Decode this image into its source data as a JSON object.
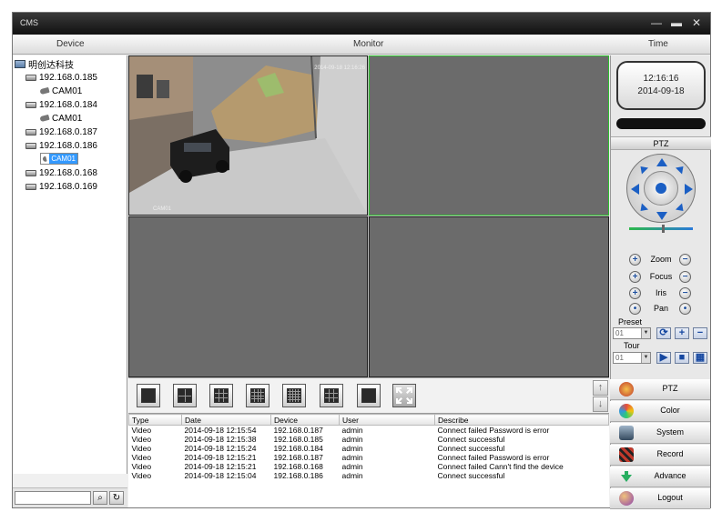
{
  "window": {
    "title": "CMS",
    "minimize_glyph": "—",
    "maximize_glyph": "▬",
    "close_glyph": "✕"
  },
  "columns": {
    "device": "Device",
    "monitor": "Monitor",
    "time": "Time"
  },
  "tree": {
    "root": "明创达科技",
    "nodes": [
      {
        "label": "192.168.0.185",
        "kind": "dvr"
      },
      {
        "label": "CAM01",
        "kind": "cam"
      },
      {
        "label": "192.168.0.184",
        "kind": "dvr"
      },
      {
        "label": "CAM01",
        "kind": "cam"
      },
      {
        "label": "192.168.0.187",
        "kind": "dvr"
      },
      {
        "label": "192.168.0.186",
        "kind": "dvr"
      },
      {
        "label": "CAM01",
        "kind": "cam",
        "selected": true
      },
      {
        "label": "192.168.0.168",
        "kind": "dvr"
      },
      {
        "label": "192.168.0.169",
        "kind": "dvr"
      }
    ]
  },
  "search": {
    "placeholder": "",
    "search_icon": "magnifier-icon",
    "refresh_icon": "refresh-icon"
  },
  "video": {
    "osd_time": "2014-09-18 12:16:26",
    "osd_name": "CAM01"
  },
  "layout_buttons": [
    "1x1",
    "2x2",
    "3x3",
    "4x4",
    "5x5",
    "6x6",
    "7x7",
    "fullscreen"
  ],
  "log": {
    "headers": [
      "Type",
      "Date",
      "Device",
      "User",
      "Describe"
    ],
    "rows": [
      [
        "Video",
        "2014-09-18 12:15:54",
        "192.168.0.187",
        "admin",
        "Connect failed Password is error"
      ],
      [
        "Video",
        "2014-09-18 12:15:38",
        "192.168.0.185",
        "admin",
        "Connect successful"
      ],
      [
        "Video",
        "2014-09-18 12:15:24",
        "192.168.0.184",
        "admin",
        "Connect successful"
      ],
      [
        "Video",
        "2014-09-18 12:15:21",
        "192.168.0.187",
        "admin",
        "Connect failed Password is error"
      ],
      [
        "Video",
        "2014-09-18 12:15:21",
        "192.168.0.168",
        "admin",
        "Connect failed Cann't find the device"
      ],
      [
        "Video",
        "2014-09-18 12:15:04",
        "192.168.0.186",
        "admin",
        "Connect successful"
      ]
    ]
  },
  "clock": {
    "time": "12:16:16",
    "date": "2014-09-18"
  },
  "ptz": {
    "title": "PTZ",
    "zoom": "Zoom",
    "focus": "Focus",
    "iris": "Iris",
    "pan": "Pan",
    "preset_label": "Preset",
    "preset_value": "01",
    "tour_label": "Tour",
    "tour_value": "01",
    "plus_glyph": "+",
    "minus_glyph": "−",
    "dot_glyph": "•",
    "dropdown_glyph": "▼",
    "preset_call_glyph": "⟳",
    "preset_add_glyph": "+",
    "preset_remove_glyph": "−",
    "tour_play_glyph": "▶",
    "tour_stop_glyph": "■",
    "tour_grid_glyph": "▦"
  },
  "scroll": {
    "up_glyph": "↑",
    "down_glyph": "↓"
  },
  "menu": [
    {
      "label": "PTZ",
      "icon": "ptz-icon",
      "color": "#c0392b"
    },
    {
      "label": "Color",
      "icon": "color-icon",
      "color": "#e67e22"
    },
    {
      "label": "System",
      "icon": "system-icon",
      "color": "#34495e"
    },
    {
      "label": "Record",
      "icon": "record-icon",
      "color": "#c0392b"
    },
    {
      "label": "Advance",
      "icon": "advance-icon",
      "color": "#27ae60"
    },
    {
      "label": "Logout",
      "icon": "logout-icon",
      "color": "#8e44ad"
    }
  ]
}
